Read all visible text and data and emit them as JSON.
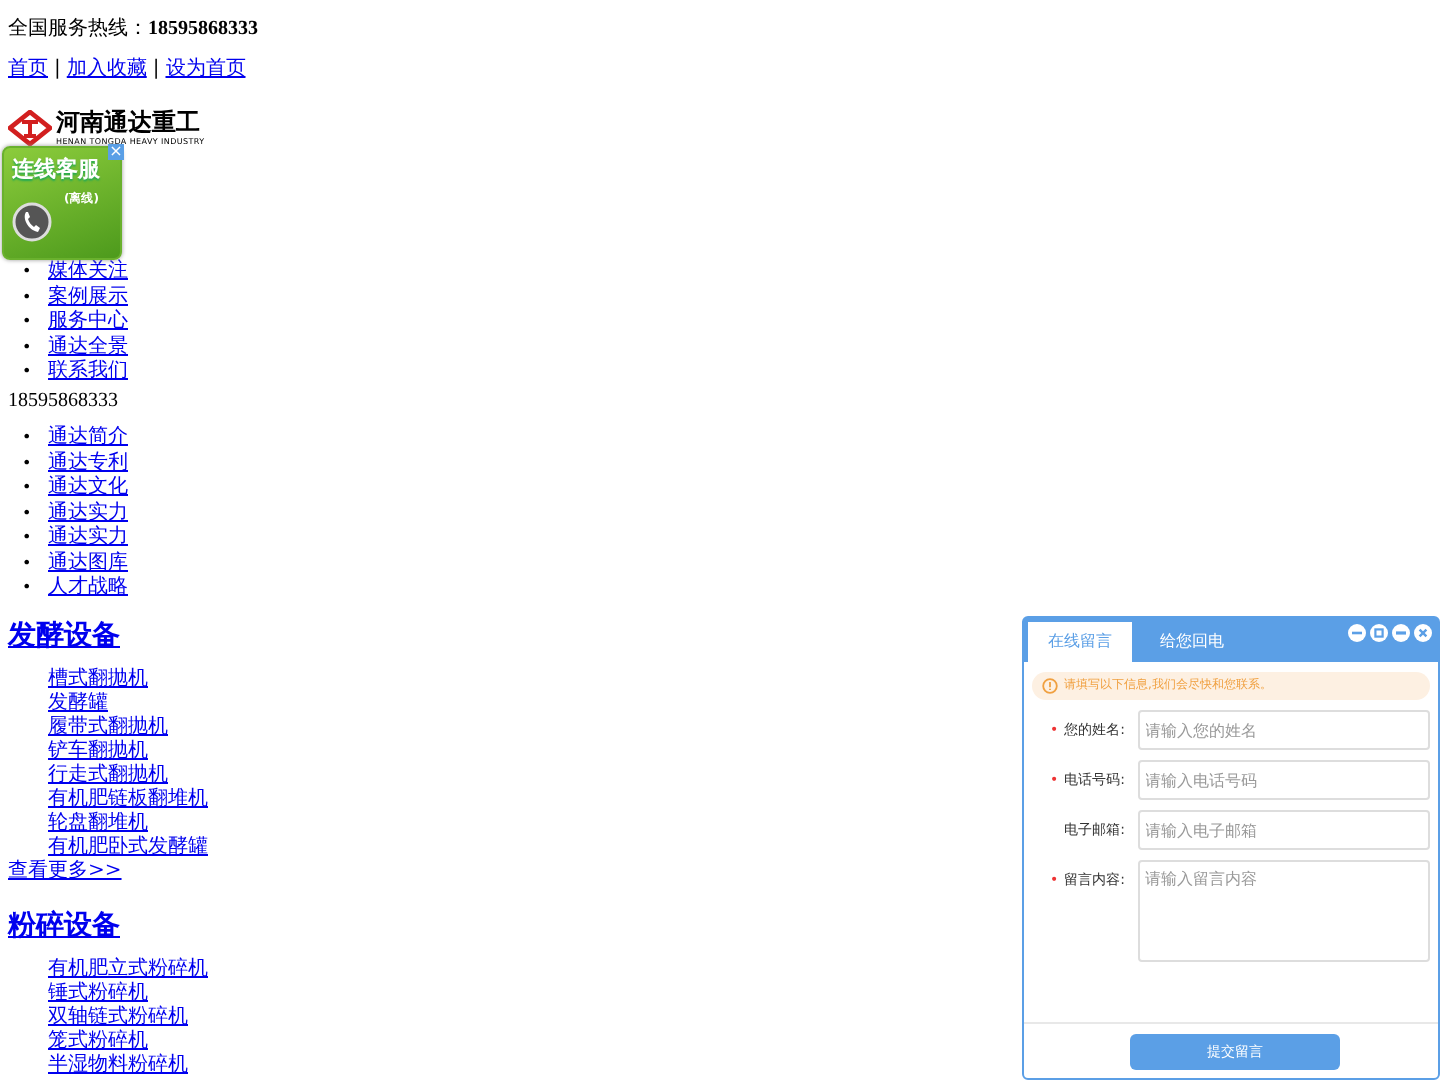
{
  "hotline": {
    "label": "全国服务热线：",
    "number": "18595868333"
  },
  "top_links": [
    "首页",
    "加入收藏",
    "设为首页"
  ],
  "link_separator": "|",
  "list_bullet": "•",
  "logo": {
    "name": "河南通达重工",
    "subtitle": "HENAN TONGDA HEAVY INDUSTRY"
  },
  "float_ad": {
    "title": "连线客服",
    "status": "(离线)",
    "close": "×"
  },
  "nav": [
    "媒体关注",
    "案例展示",
    "服务中心",
    "通达全景",
    "联系我们"
  ],
  "phone": "18595868333",
  "about_links": [
    "通达简介",
    "通达专利",
    "通达文化",
    "通达实力",
    "通达实力",
    "通达图库",
    "人才战略"
  ],
  "sections": [
    {
      "title": "发酵设备",
      "items": [
        "槽式翻抛机",
        "发酵罐",
        "履带式翻抛机",
        "铲车翻抛机",
        "行走式翻抛机",
        "有机肥链板翻堆机",
        "轮盘翻堆机",
        "有机肥卧式发酵罐"
      ],
      "more": "查看更多>>"
    },
    {
      "title": "粉碎设备",
      "items": [
        "有机肥立式粉碎机",
        "锤式粉碎机",
        "双轴链式粉碎机",
        "笼式粉碎机",
        "半湿物料粉碎机"
      ]
    }
  ],
  "chat_widget": {
    "tabs": [
      {
        "label": "在线留言",
        "selected": true
      },
      {
        "label": "给您回电",
        "selected": false
      }
    ],
    "notice": "请填写以下信息,我们会尽快和您联系。",
    "required_mark": "•",
    "fields": [
      {
        "label": "您的姓名:",
        "required": true,
        "placeholder": "请输入您的姓名",
        "kind": "input"
      },
      {
        "label": "电话号码:",
        "required": true,
        "placeholder": "请输入电话号码",
        "kind": "input"
      },
      {
        "label": "电子邮箱:",
        "required": false,
        "placeholder": "请输入电子邮箱",
        "kind": "input"
      },
      {
        "label": "留言内容:",
        "required": true,
        "placeholder": "请输入留言内容",
        "kind": "textarea"
      }
    ],
    "submit": "提交留言"
  }
}
